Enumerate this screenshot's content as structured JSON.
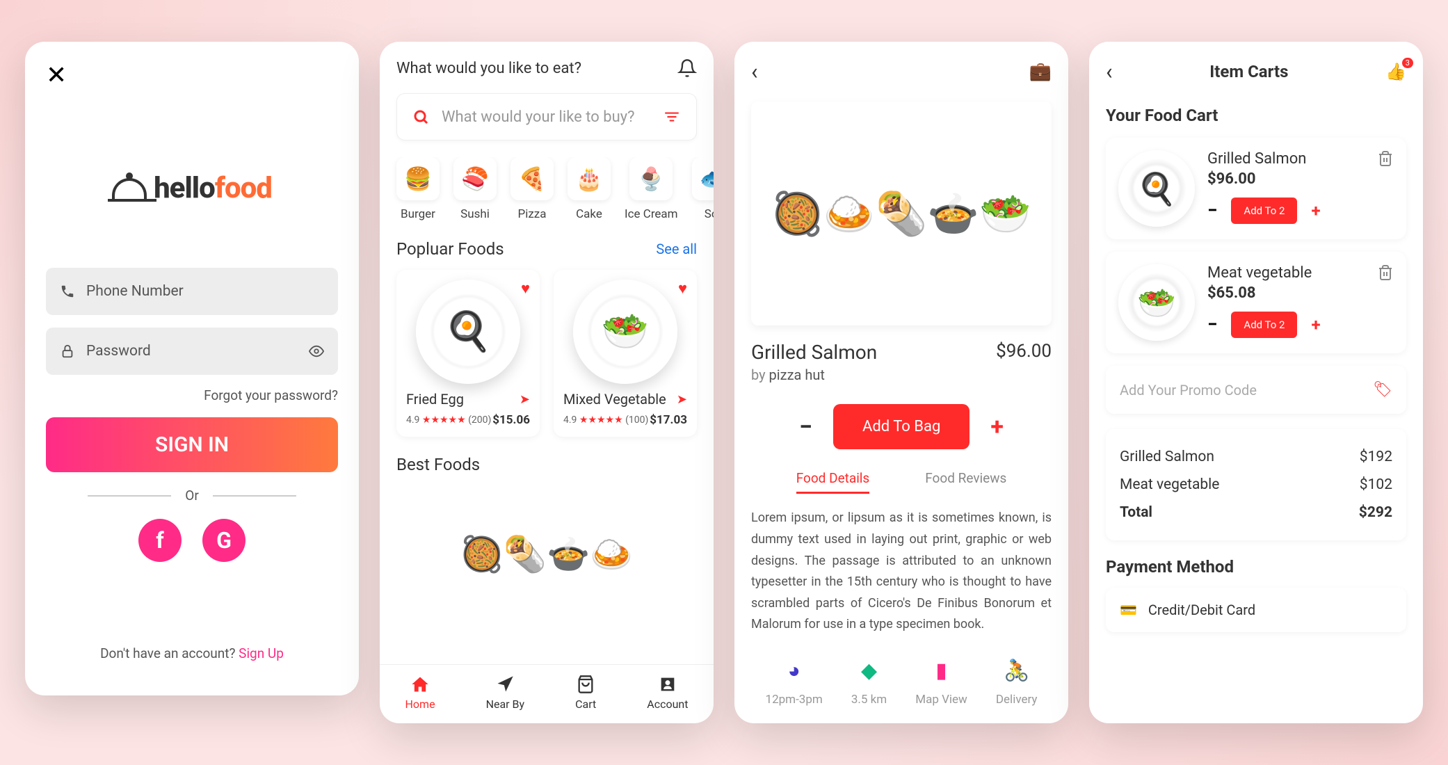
{
  "s1": {
    "logoDark": "hello",
    "logoOrange": "food",
    "phonePh": "Phone Number",
    "passPh": "Password",
    "forgot": "Forgot your password?",
    "signin": "SIGN IN",
    "or": "Or",
    "fb": "f",
    "g": "G",
    "noAccount": "Don't have an account? ",
    "signup": "Sign Up"
  },
  "s2": {
    "headTitle": "What would you like to eat?",
    "searchPh": "What would your like to buy?",
    "cats": [
      {
        "icon": "🍔",
        "label": "Burger"
      },
      {
        "icon": "🍣",
        "label": "Sushi"
      },
      {
        "icon": "🍕",
        "label": "Pizza"
      },
      {
        "icon": "🎂",
        "label": "Cake"
      },
      {
        "icon": "🍨",
        "label": "Ice Cream"
      },
      {
        "icon": "🐟",
        "label": "Sof"
      }
    ],
    "sec1": "Popluar Foods",
    "seeAll": "See all",
    "cards": [
      {
        "emoji": "🍳",
        "title": "Fried Egg",
        "rating": "4.9",
        "count": "(200)",
        "price": "$15.06"
      },
      {
        "emoji": "🥗",
        "title": "Mixed Vegetable",
        "rating": "4.9",
        "count": "(100)",
        "price": "$17.03"
      }
    ],
    "sec2": "Best Foods",
    "nav": [
      {
        "label": "Home"
      },
      {
        "label": "Near By"
      },
      {
        "label": "Cart"
      },
      {
        "label": "Account"
      }
    ]
  },
  "s3": {
    "title": "Grilled Salmon",
    "price": "$96.00",
    "by": "by ",
    "vendor": "pizza hut",
    "addBag": "Add To Bag",
    "tab1": "Food Details",
    "tab2": "Food Reviews",
    "desc": "Lorem ipsum, or lipsum as it is sometimes known, is dummy text used in laying out print, graphic or web designs. The passage is attributed to an unknown typesetter in the 15th century who is thought to have scrambled parts of Cicero's De Finibus Bonorum et Malorum for use in a type specimen book.",
    "stats": [
      {
        "label": "12pm-3pm"
      },
      {
        "label": "3.5 km"
      },
      {
        "label": "Map View"
      },
      {
        "label": "Delivery"
      }
    ]
  },
  "s4": {
    "title": "Item Carts",
    "badge": "3",
    "yourCart": "Your Food Cart",
    "items": [
      {
        "emoji": "🍳",
        "name": "Grilled Salmon",
        "price": "$96.00",
        "btn": "Add To 2"
      },
      {
        "emoji": "🥗",
        "name": "Meat vegetable",
        "price": "$65.08",
        "btn": "Add To 2"
      }
    ],
    "promoPh": "Add Your Promo Code",
    "totals": [
      {
        "label": "Grilled Salmon",
        "value": "$192"
      },
      {
        "label": "Meat vegetable",
        "value": "$102"
      },
      {
        "label": "Total",
        "value": "$292"
      }
    ],
    "paymentTitle": "Payment Method",
    "paymentCard": "Credit/Debit Card"
  }
}
